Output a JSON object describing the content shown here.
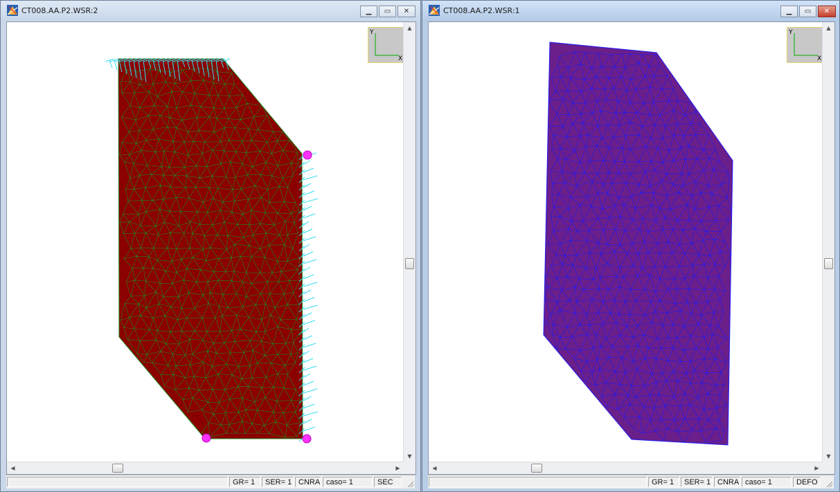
{
  "windows": [
    {
      "id": "left",
      "title": "CT008.AA.P2.WSR:2",
      "axis": {
        "y": "Y",
        "x": "X"
      },
      "status": {
        "gr": "GR=  1",
        "ser": "SER= 1",
        "cnra": "CNRA",
        "caso": "caso=   1",
        "mode": "SEC"
      },
      "mesh_fill": "#8b0000",
      "mesh_line": "#1f8a1f"
    },
    {
      "id": "right",
      "title": "CT008.AA.P2.WSR:1",
      "axis": {
        "y": "Y",
        "x": "X"
      },
      "status": {
        "gr": "GR=  1",
        "ser": "SER= 1",
        "cnra": "CNRA",
        "caso": "caso=   1",
        "mode": "DEFO"
      },
      "mesh_fill": "#6b1f8a",
      "mesh_line": "#1a1aff"
    }
  ],
  "colors": {
    "support_marker": "#ff33ff",
    "load_arrows": "#33ddee"
  },
  "icons": {
    "app": "app-mesh-icon",
    "minimize": "minimize-icon",
    "maximize": "maximize-icon",
    "close": "close-icon"
  }
}
